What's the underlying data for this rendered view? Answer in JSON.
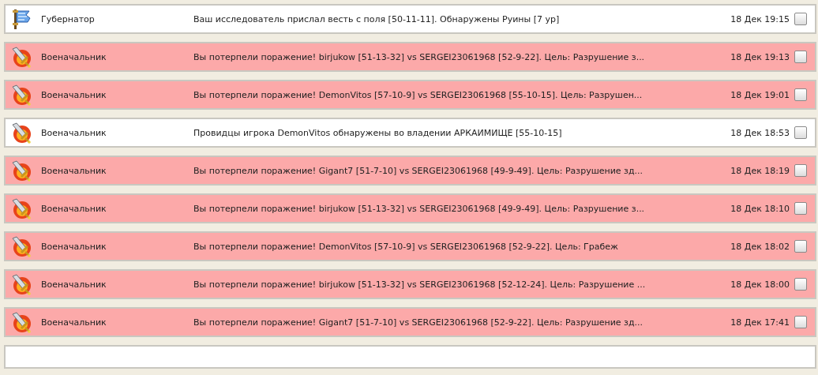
{
  "messages": [
    {
      "kind": "governor",
      "sender": "Губернатор",
      "text": "Ваш исследователь прислал весть с поля [50-11-11]. Обнаружены Руины [7 ур]",
      "time": "18 Дек 19:15",
      "alert": false,
      "checked": false
    },
    {
      "kind": "warlord",
      "sender": "Военачальник",
      "text": "Вы потерпели поражение! birjukow [51-13-32] vs SERGEI23061968 [52-9-22]. Цель: Разрушение з...",
      "time": "18 Дек 19:13",
      "alert": true,
      "checked": false
    },
    {
      "kind": "warlord",
      "sender": "Военачальник",
      "text": "Вы потерпели поражение! DemonVitos [57-10-9] vs SERGEI23061968 [55-10-15]. Цель: Разрушен...",
      "time": "18 Дек 19:01",
      "alert": true,
      "checked": false
    },
    {
      "kind": "warlord",
      "sender": "Военачальник",
      "text": "Провидцы игрока DemonVitos обнаружены во владении АРКАИМИЩЕ [55-10-15]",
      "time": "18 Дек 18:53",
      "alert": false,
      "checked": false
    },
    {
      "kind": "warlord",
      "sender": "Военачальник",
      "text": "Вы потерпели поражение! Gigant7 [51-7-10] vs SERGEI23061968 [49-9-49]. Цель: Разрушение зд...",
      "time": "18 Дек 18:19",
      "alert": true,
      "checked": false
    },
    {
      "kind": "warlord",
      "sender": "Военачальник",
      "text": "Вы потерпели поражение! birjukow [51-13-32] vs SERGEI23061968 [49-9-49]. Цель: Разрушение з...",
      "time": "18 Дек 18:10",
      "alert": true,
      "checked": false
    },
    {
      "kind": "warlord",
      "sender": "Военачальник",
      "text": "Вы потерпели поражение! DemonVitos [57-10-9] vs SERGEI23061968 [52-9-22]. Цель: Грабеж",
      "time": "18 Дек 18:02",
      "alert": true,
      "checked": false
    },
    {
      "kind": "warlord",
      "sender": "Военачальник",
      "text": "Вы потерпели поражение! birjukow [51-13-32] vs SERGEI23061968 [52-12-24]. Цель: Разрушение ...",
      "time": "18 Дек 18:00",
      "alert": true,
      "checked": false
    },
    {
      "kind": "warlord",
      "sender": "Военачальник",
      "text": "Вы потерпели поражение! Gigant7 [51-7-10] vs SERGEI23061968 [52-9-22]. Цель: Разрушение зд...",
      "time": "18 Дек 17:41",
      "alert": true,
      "checked": false
    }
  ]
}
